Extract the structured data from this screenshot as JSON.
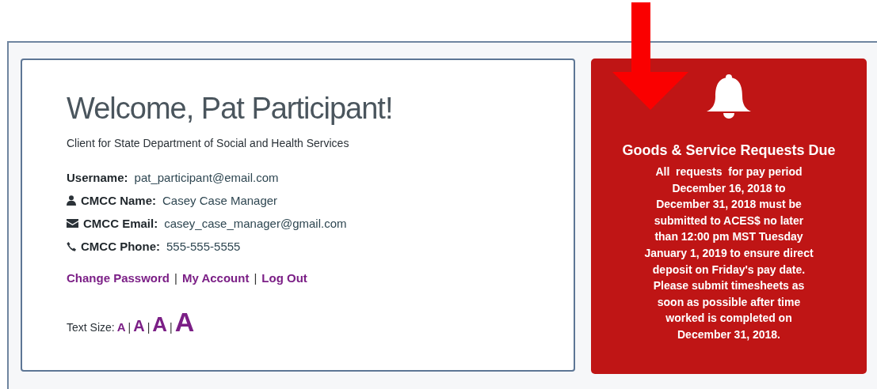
{
  "welcome": {
    "title": "Welcome, Pat Participant!",
    "subtitle": "Client for State Department of Social and Health Services",
    "details": [
      {
        "kind": "plain",
        "label": "Username:",
        "value": "pat_participant@email.com"
      },
      {
        "kind": "person",
        "label": "CMCC Name:",
        "value": "Casey Case Manager"
      },
      {
        "kind": "email",
        "label": "CMCC Email:",
        "value": "casey_case_manager@gmail.com"
      },
      {
        "kind": "phone",
        "label": "CMCC Phone:",
        "value": "555-555-5555"
      }
    ],
    "links": [
      "Change Password",
      "My Account",
      "Log Out"
    ],
    "separator": "|",
    "text_size": {
      "label": "Text Size:",
      "options": [
        "A",
        "A",
        "A",
        "A"
      ]
    }
  },
  "notice": {
    "title": "Goods & Service Requests Due",
    "lines": [
      "All  requests  for pay period",
      "December 16, 2018 to",
      "December 31, 2018 must be",
      "submitted to ACES$ no later",
      "than 12:00 pm MST Tuesday",
      "January 1, 2019 to ensure direct",
      "deposit on Friday's pay date.",
      "Please submit timesheets as",
      "soon as possible after time",
      "worked is completed on",
      "December 31, 2018."
    ]
  }
}
